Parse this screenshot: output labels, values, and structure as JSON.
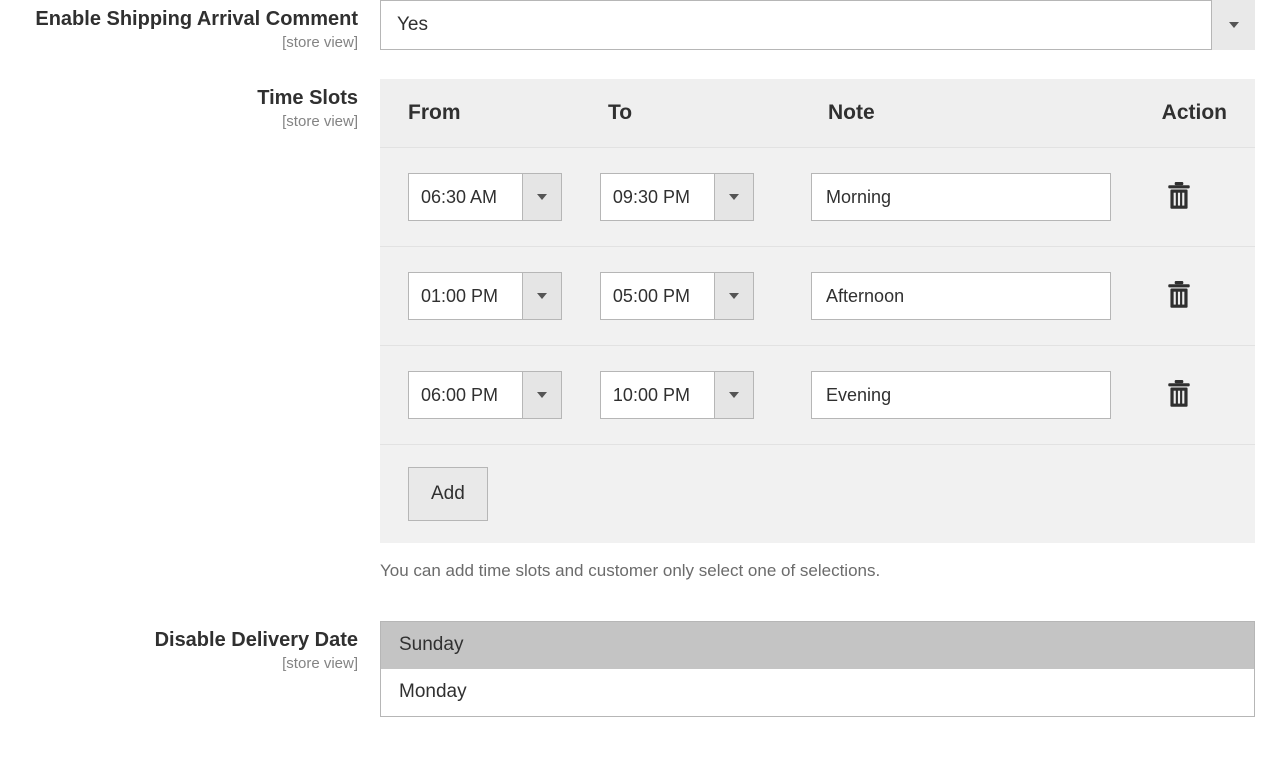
{
  "scope_hint": "[store view]",
  "enable_comment": {
    "label": "Enable Shipping Arrival Comment",
    "value": "Yes"
  },
  "time_slots": {
    "label": "Time Slots",
    "columns": {
      "from": "From",
      "to": "To",
      "note": "Note",
      "action": "Action"
    },
    "rows": [
      {
        "from": "06:30 AM",
        "to": "09:30 PM",
        "note": "Morning"
      },
      {
        "from": "01:00 PM",
        "to": "05:00 PM",
        "note": "Afternoon"
      },
      {
        "from": "06:00 PM",
        "to": "10:00 PM",
        "note": "Evening"
      }
    ],
    "add_label": "Add",
    "help": "You can add time slots and customer only select one of selections."
  },
  "disable_date": {
    "label": "Disable Delivery Date",
    "options": [
      "Sunday",
      "Monday"
    ],
    "selected_index": 0
  }
}
